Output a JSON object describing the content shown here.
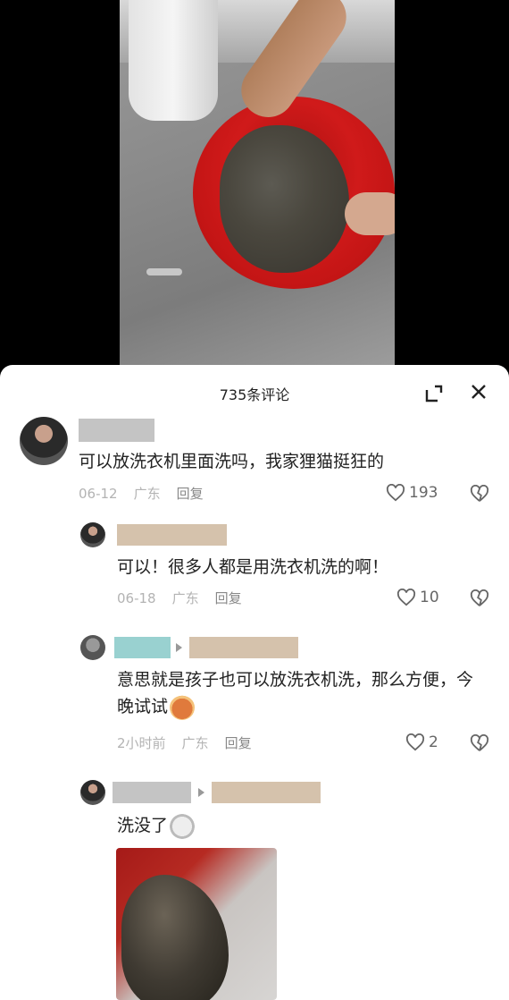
{
  "sheet": {
    "title": "735条评论",
    "expand_icon": "expand-icon",
    "close_icon": "close-icon"
  },
  "comments": [
    {
      "text": "可以放洗衣机里面洗吗，我家狸猫挺狂的",
      "date": "06-12",
      "location": "广东",
      "reply_label": "回复",
      "likes": "193",
      "name_mask_color": "#c4c4c4"
    },
    {
      "text": "可以！很多人都是用洗衣机洗的啊！",
      "date": "06-18",
      "location": "广东",
      "reply_label": "回复",
      "likes": "10",
      "name_mask_color": "#d5c2ac"
    },
    {
      "text": "意思就是孩子也可以放洗衣机洗，那么方便，今晚试试",
      "date": "2小时前",
      "location": "广东",
      "reply_label": "回复",
      "likes": "2",
      "name_mask_color": "#99d1d0",
      "reply_to_mask_color": "#d5c2ac"
    },
    {
      "text": "洗没了",
      "name_mask_color": "#c4c4c4",
      "reply_to_mask_color": "#d5c2ac"
    }
  ],
  "colors": {
    "meta_text": "#b3b3b3",
    "body_text": "#222222"
  }
}
